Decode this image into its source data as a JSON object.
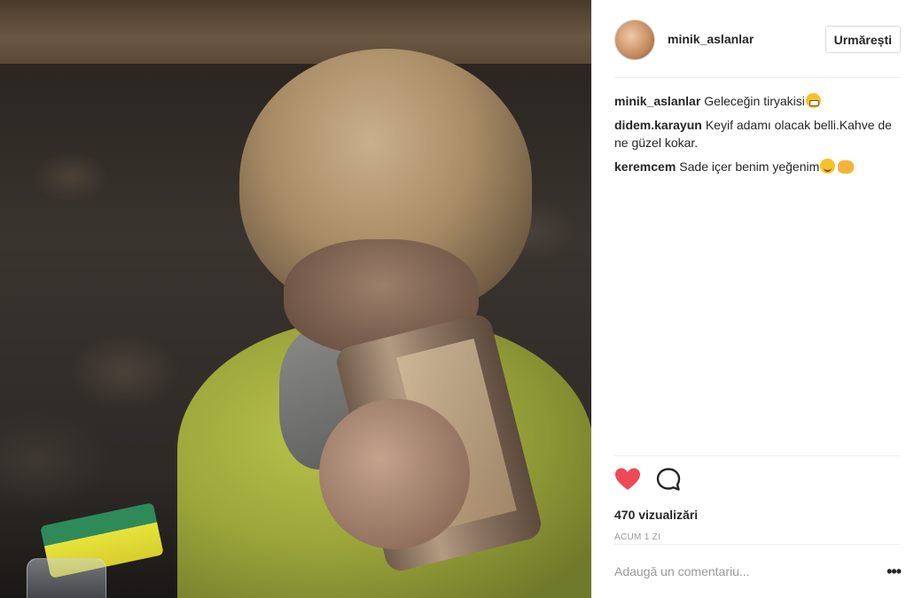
{
  "post": {
    "username": "minik_aslanlar",
    "follow_label": "Urmărești",
    "caption_author": "minik_aslanlar",
    "caption_text": "Geleceğin tiryakisi"
  },
  "comments": [
    {
      "author": "didem.karayun",
      "text": "Keyif adamı olacak belli.Kahve de ne güzel kokar."
    },
    {
      "author": "keremcem",
      "text": "Sade içer benim yeğenim"
    }
  ],
  "stats": {
    "views_count": "470",
    "views_label": "vizualizări",
    "timestamp": "ACUM 1 ZI"
  },
  "composer": {
    "placeholder": "Adaugă un comentariu...",
    "more_label": "•••"
  },
  "icons": {
    "like": "heart-icon",
    "comment": "comment-bubble-icon",
    "more": "more-options-icon"
  },
  "colors": {
    "like_active": "#ed4956",
    "text": "#262626",
    "muted": "#999999",
    "divider": "#efefef"
  }
}
